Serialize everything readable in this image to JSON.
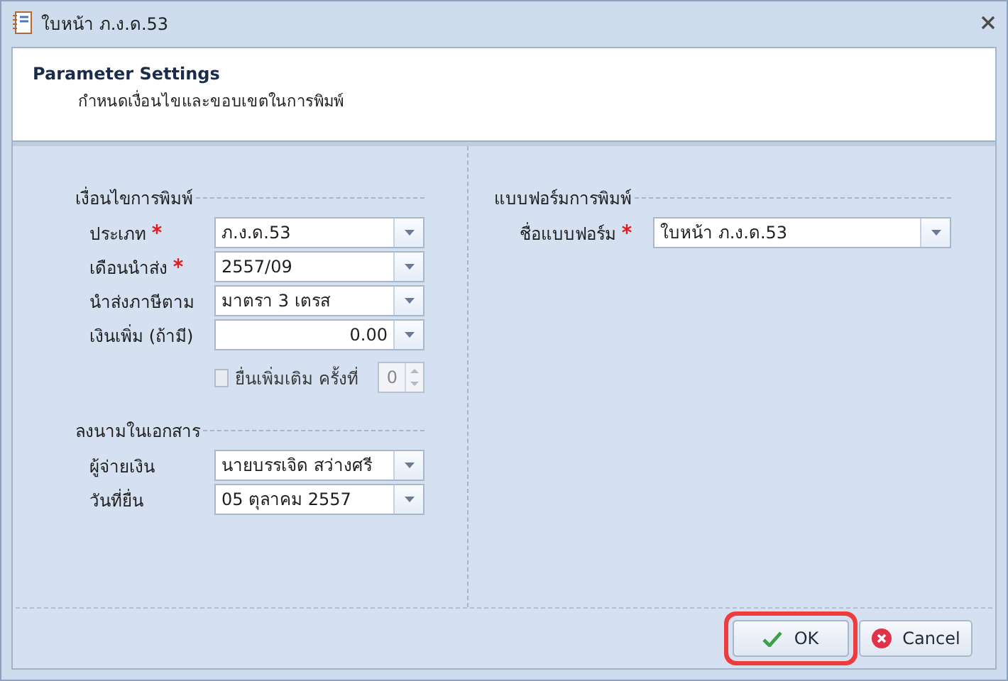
{
  "window": {
    "title": "ใบหน้า ภ.ง.ด.53"
  },
  "header": {
    "title": "Parameter Settings",
    "subtitle": "กำหนดเงื่อนไขและขอบเขตในการพิมพ์"
  },
  "columns": [
    {
      "groups": [
        {
          "title": "เงื่อนไขการพิมพ์",
          "fields": [
            {
              "kind": "combo",
              "label": "ประเภท",
              "required": true,
              "value": "ภ.ง.ด.53"
            },
            {
              "kind": "combo",
              "label": "เดือนนำส่ง",
              "required": true,
              "value": "2557/09"
            },
            {
              "kind": "combo",
              "label": "นำส่งภาษีตาม",
              "required": false,
              "value": "มาตรา 3 เตรส"
            },
            {
              "kind": "number",
              "label": "เงินเพิ่ม (ถ้ามี)",
              "required": false,
              "value": "0.00"
            },
            {
              "kind": "checkbox",
              "label": "ยื่นเพิ่มเติม ครั้งที่",
              "checked": false,
              "disabled": true,
              "value": "0"
            }
          ]
        },
        {
          "title": "ลงนามในเอกสาร",
          "fields": [
            {
              "kind": "combo",
              "label": "ผู้จ่ายเงิน",
              "required": false,
              "value": "นายบรรเจิด สว่างศรี"
            },
            {
              "kind": "combo",
              "label": "วันที่ยื่น",
              "required": false,
              "value": "05 ตุลาคม 2557"
            }
          ]
        }
      ]
    },
    {
      "groups": [
        {
          "title": "แบบฟอร์มการพิมพ์",
          "fields": [
            {
              "kind": "combo",
              "label": "ชื่อแบบฟอร์ม",
              "required": true,
              "value": "ใบหน้า ภ.ง.ด.53"
            }
          ]
        }
      ]
    }
  ],
  "buttons": [
    {
      "kind": "ok",
      "label": "OK",
      "highlighted": true
    },
    {
      "kind": "cancel",
      "label": "Cancel",
      "highlighted": false
    }
  ]
}
